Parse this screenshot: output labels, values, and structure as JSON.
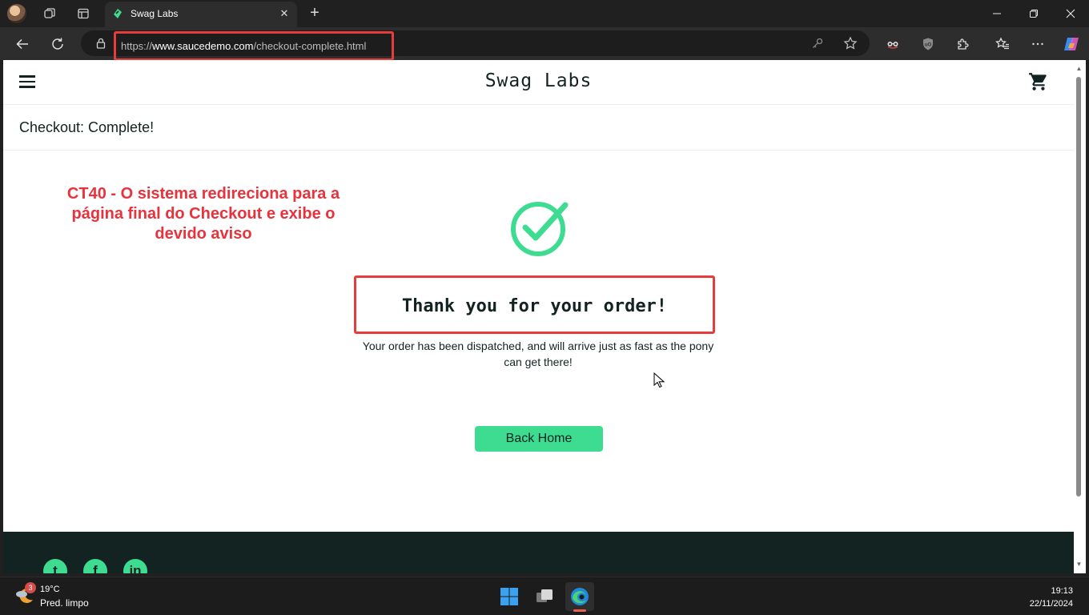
{
  "browser": {
    "tab_title": "Swag Labs",
    "tab_close": "✕",
    "new_tab": "+",
    "url_prefix": "https://",
    "url_host": "www.saucedemo.com",
    "url_path": "/checkout-complete.html"
  },
  "app": {
    "logo": "Swag Labs",
    "page_title": "Checkout: Complete!",
    "complete_header": "Thank you for your order!",
    "complete_text": "Your order has been dispatched, and will arrive just as fast as the pony can get there!",
    "back_home": "Back Home",
    "annotation": "CT40 - O sistema redireciona para a página final do Checkout e exibe o devido aviso",
    "accent_color": "#3ddc91",
    "highlight_color": "#e63c3c"
  },
  "footer": {
    "social": [
      "twitter-icon",
      "facebook-icon",
      "linkedin-icon"
    ],
    "twitter_glyph": "t",
    "facebook_glyph": "f",
    "linkedin_glyph": "in"
  },
  "taskbar": {
    "weather_badge": "3",
    "temperature": "19°C",
    "condition": "Pred. limpo",
    "time": "19:13",
    "date": "22/11/2024"
  }
}
